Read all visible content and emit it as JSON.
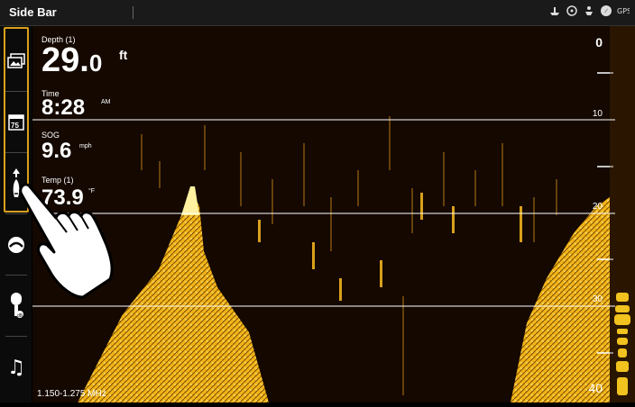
{
  "topbar": {
    "title": "Side Bar",
    "icons": [
      "boat-icon",
      "steering-wheel-icon",
      "anchor-icon",
      "compass-icon",
      "gps-icon"
    ]
  },
  "sidebar": {
    "buttons": [
      {
        "name": "image-gallery",
        "icon": "gallery-icon"
      },
      {
        "name": "temperature-widget",
        "icon": "thermometer-gauge-icon",
        "glyph": "75"
      },
      {
        "name": "navigation-widget",
        "icon": "navigation-arrow-icon",
        "active": true
      },
      {
        "name": "trolling-motor",
        "icon": "steering-icon"
      },
      {
        "name": "microphone",
        "icon": "microphone-icon"
      },
      {
        "name": "music",
        "icon": "music-note-icon",
        "glyph": "♫"
      }
    ]
  },
  "overlays": {
    "depth": {
      "label": "Depth (1)",
      "value_main": "29.",
      "value_frac": "0",
      "unit": "ft"
    },
    "time": {
      "label": "Time",
      "value": "8:28",
      "unit": "AM"
    },
    "sog": {
      "label": "SOG",
      "value": "9.6",
      "unit": "mph"
    },
    "temp": {
      "label": "Temp (1)",
      "value": "73.9",
      "unit": "°F"
    },
    "voltage_unit": "V"
  },
  "depth_scale": {
    "marks": [
      "0",
      "10",
      "20",
      "30",
      "40"
    ]
  },
  "frequency": "1.150-1.275 MHz",
  "colors": {
    "accent": "#d9a01c",
    "sonar_yellow": "#f2c21e",
    "sonar_bg": "#140800"
  }
}
